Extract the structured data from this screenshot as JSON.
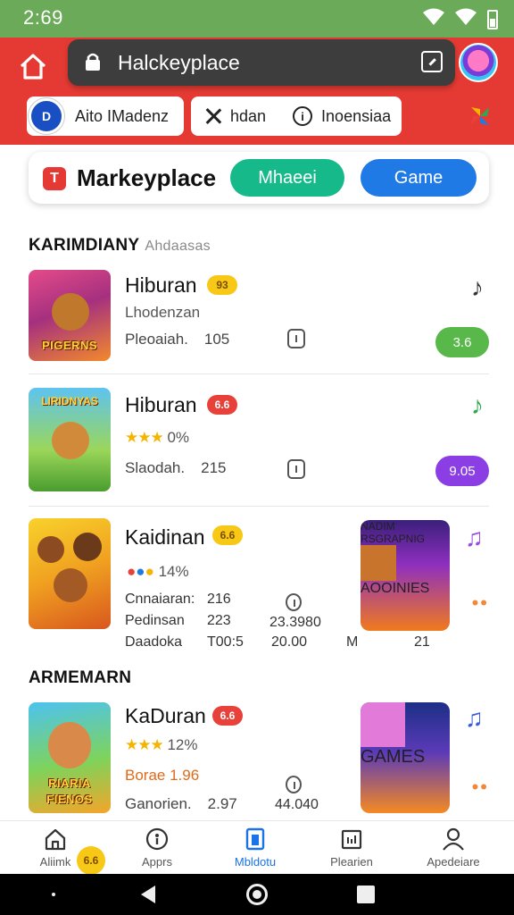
{
  "status_bar": {
    "time": "2:69"
  },
  "browser": {
    "url": "Halckeyplace",
    "chips": [
      {
        "icon_text": "D",
        "label": "Aito IMadenz"
      },
      {
        "label_x": "hdan",
        "label_info": "Inoensiaa"
      }
    ]
  },
  "market": {
    "logo_text": "T",
    "title": "Markeyplace",
    "pill_green": "Mhaeei",
    "pill_blue": "Game"
  },
  "sections": [
    {
      "title": "KARIMDIANY",
      "subtitle": "Ahdaasas"
    },
    {
      "title": "ARMEMARN"
    }
  ],
  "items": [
    {
      "thumb_label": "PIGERNS",
      "title": "Hiburan",
      "badge": "93",
      "subline": "Lhodenzan",
      "meta_label": "Pleoaiah.",
      "meta_num": "105",
      "action": "3.6",
      "action_color": "#58b84a",
      "note_color": "#333333"
    },
    {
      "thumb_label": "LIRIDNYAS",
      "title": "Hiburan",
      "badge": "6.6",
      "rating": "★★★",
      "rating_text": "0%",
      "meta_label": "Slaodah.",
      "meta_num": "215",
      "action": "9.05",
      "action_color": "#8b3ee3",
      "note_color": "#2fa84f"
    },
    {
      "title": "Kaidinan",
      "badge": "6.6",
      "rating_text": "14%",
      "lines": [
        {
          "label": "Cnnaiaran:",
          "num": "216",
          "extra": ""
        },
        {
          "label": "Pedinsan",
          "num": "223",
          "extra": "23.3980"
        },
        {
          "label": "Daadoka",
          "num": "T00:5",
          "extra": "20.00"
        }
      ],
      "tail_a": "M",
      "tail_b": "21",
      "big_thumb_top": "NADIM RSGRAPNIG",
      "big_thumb_bottom": "AOOINIES",
      "note_color": "#9b4de0"
    },
    {
      "thumb_top": "RIARIA",
      "thumb_label": "FIENOS",
      "title": "KaDuran",
      "badge": "6.6",
      "rating": "★★★",
      "rating_text": "12%",
      "score_line": "Borae 1.96",
      "meta_label": "Ganorien.",
      "meta_num": "2.97",
      "extra": "44.040",
      "big_thumb_bottom": "GAMES",
      "note_color": "#3b5fd8"
    }
  ],
  "bottom_nav": {
    "items": [
      {
        "label": "Aliimk"
      },
      {
        "label": "Apprs"
      },
      {
        "label": "Mbldotu"
      },
      {
        "label": "Plearien"
      },
      {
        "label": "Apedeiare"
      }
    ],
    "badge": "6.6"
  }
}
